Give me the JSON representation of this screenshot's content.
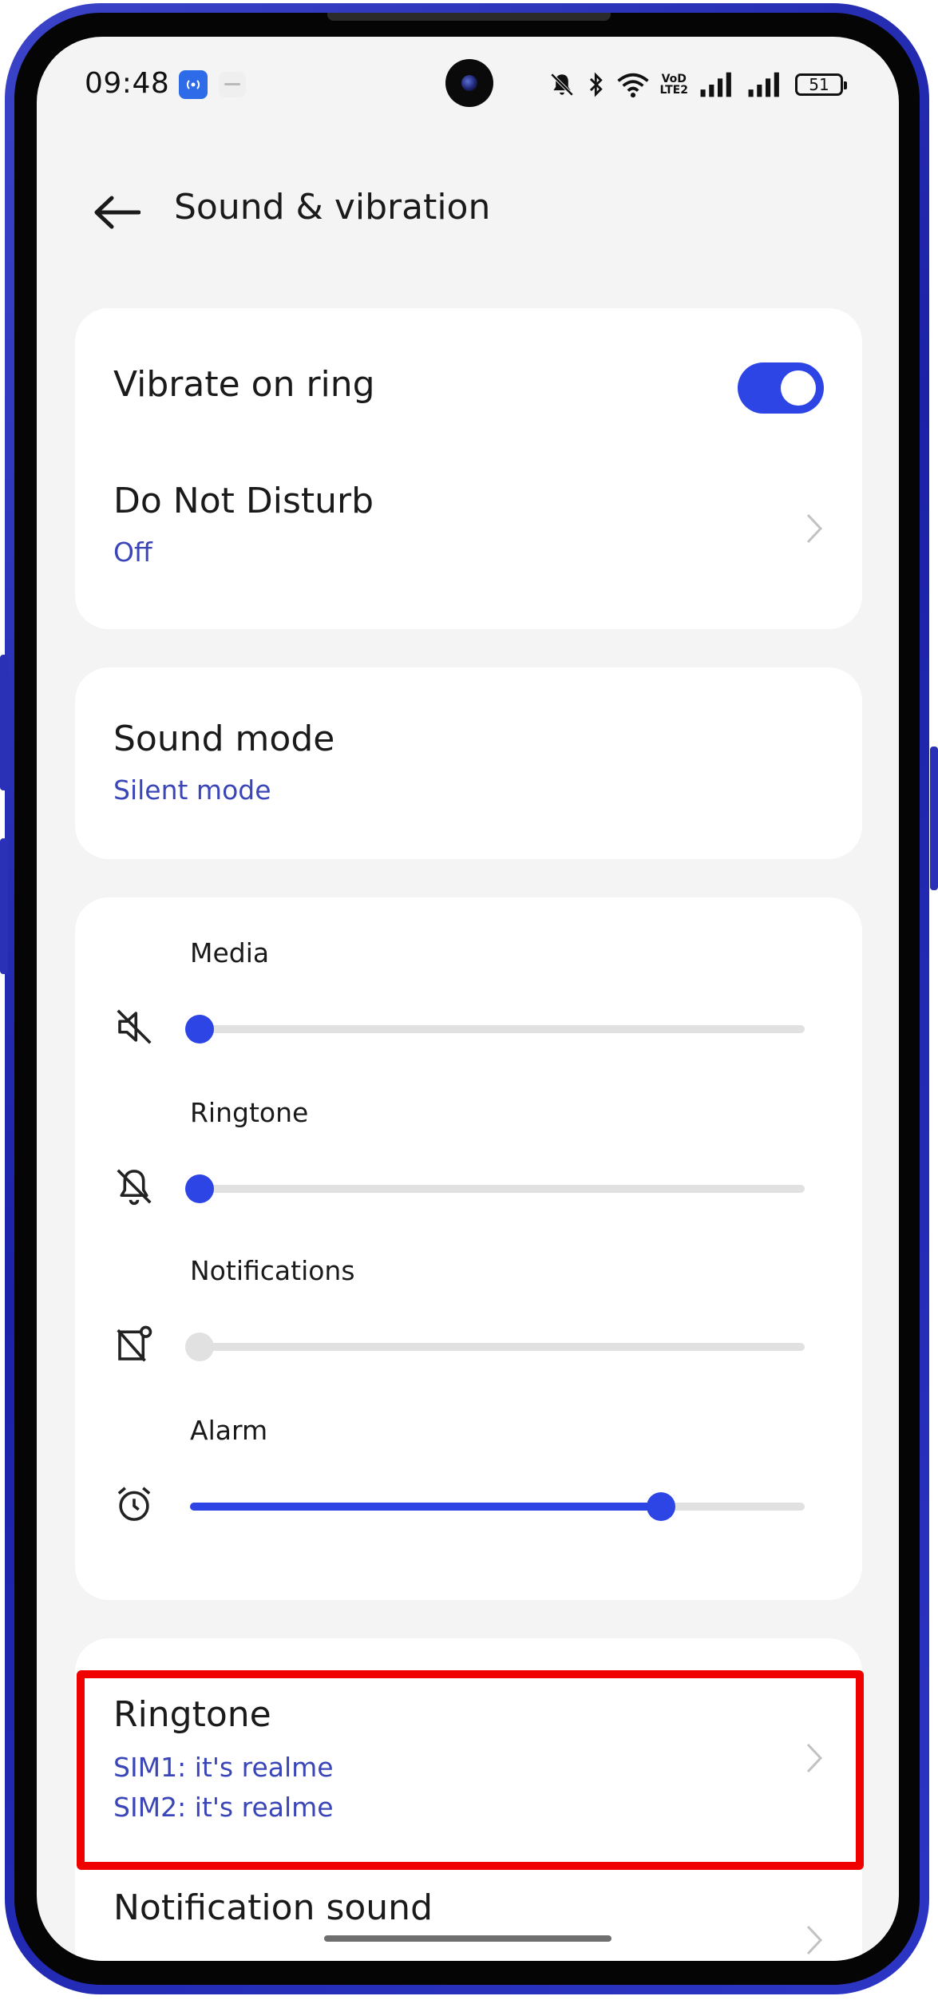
{
  "status_bar": {
    "time": "09:48",
    "battery": "51",
    "volte_top": "VoD",
    "volte_bottom": "LTE2",
    "icons": [
      "hotspot-app-icon",
      "app-icon",
      "mute-bell-icon",
      "bluetooth-icon",
      "wifi-icon",
      "volte-icon",
      "signal-icon",
      "signal-icon",
      "battery-icon"
    ]
  },
  "header": {
    "back_icon": "arrow-left-icon",
    "title": "Sound & vibration"
  },
  "settings_card_1": {
    "vibrate_on_ring": {
      "label": "Vibrate on ring",
      "enabled": true
    },
    "do_not_disturb": {
      "label": "Do Not Disturb",
      "value": "Off"
    }
  },
  "settings_card_2": {
    "sound_mode": {
      "label": "Sound mode",
      "value": "Silent mode"
    }
  },
  "volume": {
    "media": {
      "label": "Media",
      "icon": "speaker-muted-icon",
      "level": 0,
      "enabled": true
    },
    "ringtone": {
      "label": "Ringtone",
      "icon": "bell-muted-icon",
      "level": 0,
      "enabled": true
    },
    "notifications": {
      "label": "Notifications",
      "icon": "notification-muted-icon",
      "level": 0,
      "enabled": false
    },
    "alarm": {
      "label": "Alarm",
      "icon": "alarm-clock-icon",
      "level": 0.75,
      "enabled": true
    }
  },
  "sounds_card": {
    "ringtone": {
      "label": "Ringtone",
      "sim1": "SIM1: it's realme",
      "sim2": "SIM2: it's realme"
    },
    "notification_sound": {
      "label": "Notification sound"
    }
  },
  "colors": {
    "accent": "#2e45e6",
    "subtext": "#3a45b8",
    "highlight": "#f10000",
    "frame": "#2a31b8"
  }
}
